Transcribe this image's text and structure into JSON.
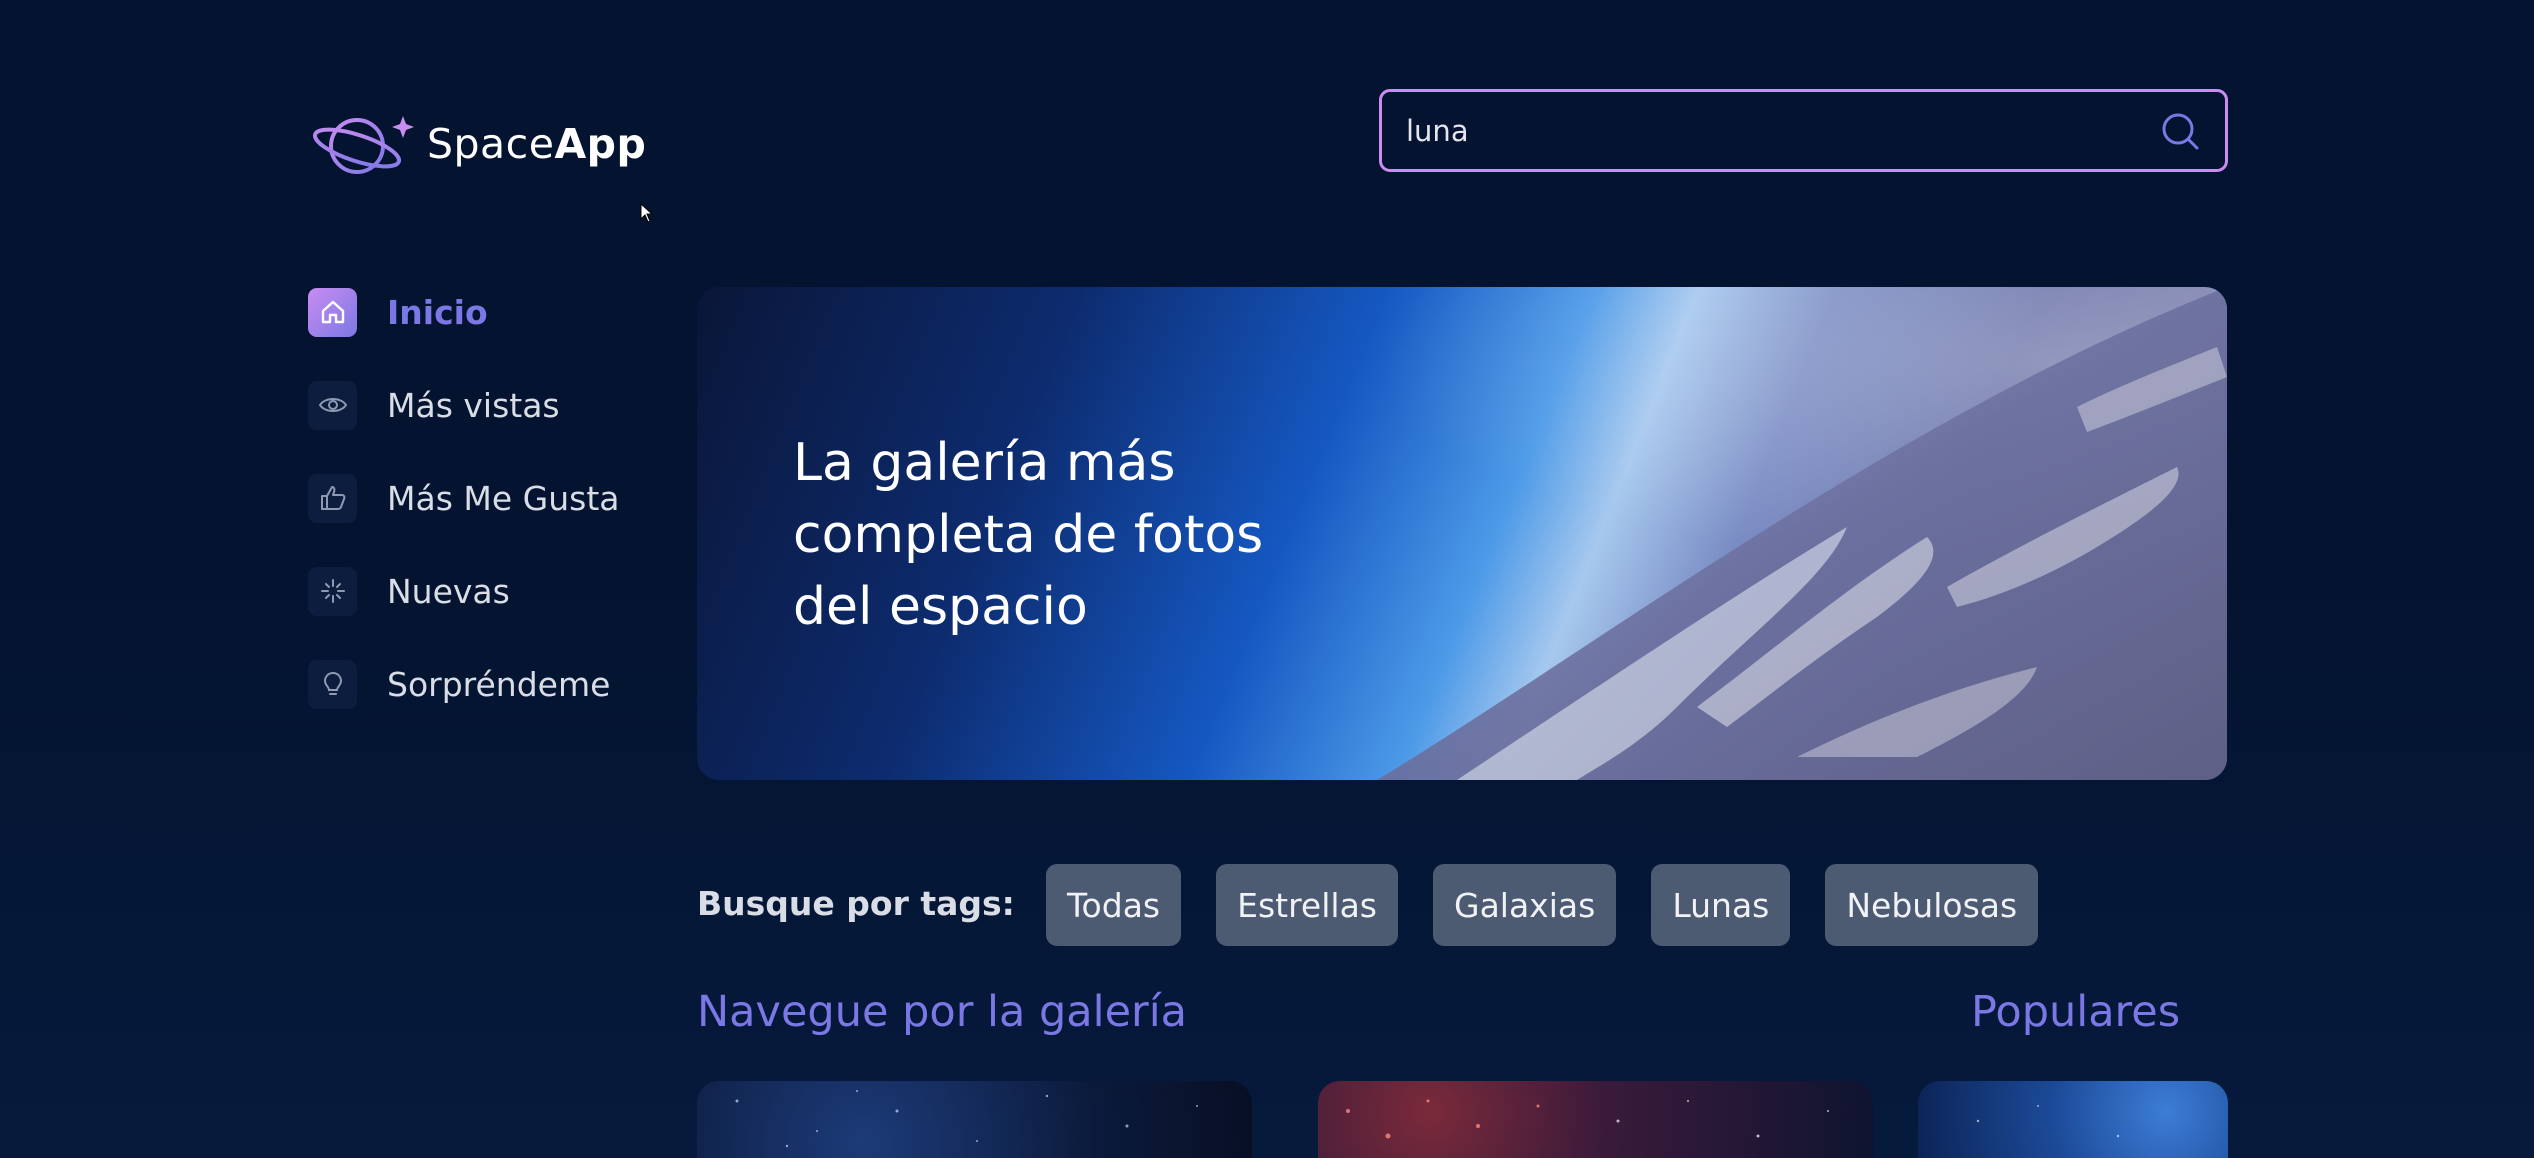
{
  "logo": {
    "text_light": "Space",
    "text_bold": "App",
    "icon": "planet-icon"
  },
  "search": {
    "value": "luna",
    "placeholder": "",
    "icon": "search-icon"
  },
  "sidebar": {
    "items": [
      {
        "label": "Inicio",
        "icon": "home-icon",
        "active": true
      },
      {
        "label": "Más vistas",
        "icon": "eye-icon",
        "active": false
      },
      {
        "label": "Más Me Gusta",
        "icon": "thumbs-up-icon",
        "active": false
      },
      {
        "label": "Nuevas",
        "icon": "sparkle-icon",
        "active": false
      },
      {
        "label": "Sorpréndeme",
        "icon": "lightbulb-icon",
        "active": false
      }
    ]
  },
  "banner": {
    "title": "La galería más completa de fotos del espacio"
  },
  "tags": {
    "label": "Busque por tags:",
    "items": [
      "Todas",
      "Estrellas",
      "Galaxias",
      "Lunas",
      "Nebulosas"
    ]
  },
  "sections": {
    "gallery_title": "Navegue por la galería",
    "popular_title": "Populares"
  },
  "colors": {
    "accent": "#7b78e5",
    "accent_light": "#c98cf1",
    "background": "#04122f",
    "tag_bg": "#4c5a72"
  }
}
